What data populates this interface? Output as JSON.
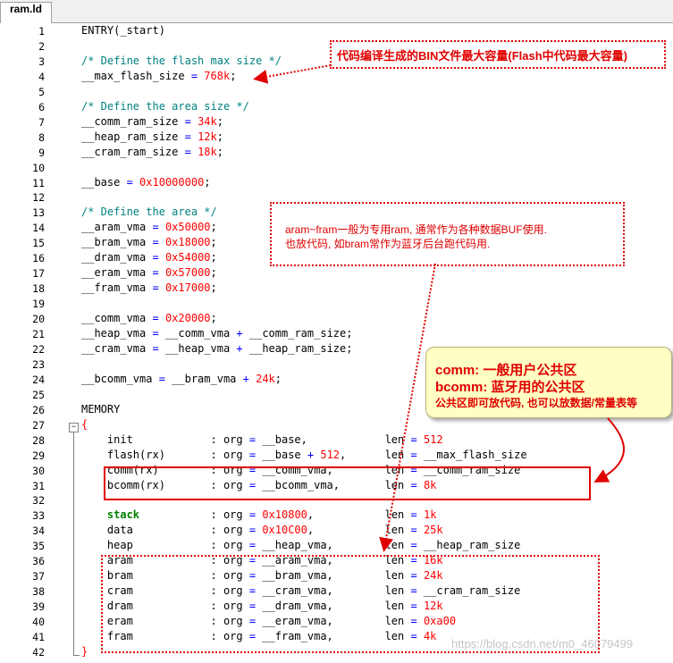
{
  "tab": {
    "label": "ram.ld"
  },
  "lines": [
    {
      "n": "1",
      "parts": [
        [
          "",
          "ENTRY(_start)"
        ]
      ]
    },
    {
      "n": "2",
      "parts": []
    },
    {
      "n": "3",
      "parts": [
        [
          "cm",
          "/* Define the flash max size */"
        ]
      ]
    },
    {
      "n": "4",
      "parts": [
        [
          "",
          "__max_flash_size "
        ],
        [
          "op",
          "="
        ],
        [
          "",
          " "
        ],
        [
          "num",
          "768k"
        ],
        [
          "",
          ";"
        ]
      ]
    },
    {
      "n": "5",
      "parts": []
    },
    {
      "n": "6",
      "parts": [
        [
          "cm",
          "/* Define the area size */"
        ]
      ]
    },
    {
      "n": "7",
      "parts": [
        [
          "",
          "__comm_ram_size "
        ],
        [
          "op",
          "="
        ],
        [
          "",
          " "
        ],
        [
          "num",
          "34k"
        ],
        [
          "",
          ";"
        ]
      ]
    },
    {
      "n": "8",
      "parts": [
        [
          "",
          "__heap_ram_size "
        ],
        [
          "op",
          "="
        ],
        [
          "",
          " "
        ],
        [
          "num",
          "12k"
        ],
        [
          "",
          ";"
        ]
      ]
    },
    {
      "n": "9",
      "parts": [
        [
          "",
          "__cram_ram_size "
        ],
        [
          "op",
          "="
        ],
        [
          "",
          " "
        ],
        [
          "num",
          "18k"
        ],
        [
          "",
          ";"
        ]
      ]
    },
    {
      "n": "10",
      "parts": []
    },
    {
      "n": "11",
      "parts": [
        [
          "",
          "__base "
        ],
        [
          "op",
          "="
        ],
        [
          "",
          " "
        ],
        [
          "num",
          "0x10000000"
        ],
        [
          "",
          ";"
        ]
      ]
    },
    {
      "n": "12",
      "parts": []
    },
    {
      "n": "13",
      "parts": [
        [
          "cm",
          "/* Define the area */"
        ]
      ]
    },
    {
      "n": "14",
      "parts": [
        [
          "",
          "__aram_vma "
        ],
        [
          "op",
          "="
        ],
        [
          "",
          " "
        ],
        [
          "num",
          "0x50000"
        ],
        [
          "",
          ";"
        ]
      ]
    },
    {
      "n": "15",
      "parts": [
        [
          "",
          "__bram_vma "
        ],
        [
          "op",
          "="
        ],
        [
          "",
          " "
        ],
        [
          "num",
          "0x18000"
        ],
        [
          "",
          ";"
        ]
      ]
    },
    {
      "n": "16",
      "parts": [
        [
          "",
          "__dram_vma "
        ],
        [
          "op",
          "="
        ],
        [
          "",
          " "
        ],
        [
          "num",
          "0x54000"
        ],
        [
          "",
          ";"
        ]
      ]
    },
    {
      "n": "17",
      "parts": [
        [
          "",
          "__eram_vma "
        ],
        [
          "op",
          "="
        ],
        [
          "",
          " "
        ],
        [
          "num",
          "0x57000"
        ],
        [
          "",
          ";"
        ]
      ]
    },
    {
      "n": "18",
      "parts": [
        [
          "",
          "__fram_vma "
        ],
        [
          "op",
          "="
        ],
        [
          "",
          " "
        ],
        [
          "num",
          "0x17000"
        ],
        [
          "",
          ";"
        ]
      ]
    },
    {
      "n": "19",
      "parts": []
    },
    {
      "n": "20",
      "parts": [
        [
          "",
          "__comm_vma "
        ],
        [
          "op",
          "="
        ],
        [
          "",
          " "
        ],
        [
          "num",
          "0x20000"
        ],
        [
          "",
          ";"
        ]
      ]
    },
    {
      "n": "21",
      "parts": [
        [
          "",
          "__heap_vma "
        ],
        [
          "op",
          "="
        ],
        [
          "",
          " __comm_vma "
        ],
        [
          "op",
          "+"
        ],
        [
          "",
          " __comm_ram_size;"
        ]
      ]
    },
    {
      "n": "22",
      "parts": [
        [
          "",
          "__cram_vma "
        ],
        [
          "op",
          "="
        ],
        [
          "",
          " __heap_vma "
        ],
        [
          "op",
          "+"
        ],
        [
          "",
          " __heap_ram_size;"
        ]
      ]
    },
    {
      "n": "23",
      "parts": []
    },
    {
      "n": "24",
      "parts": [
        [
          "",
          "__bcomm_vma "
        ],
        [
          "op",
          "="
        ],
        [
          "",
          " __bram_vma "
        ],
        [
          "op",
          "+"
        ],
        [
          "",
          " "
        ],
        [
          "num",
          "24k"
        ],
        [
          "",
          ";"
        ]
      ]
    },
    {
      "n": "25",
      "parts": []
    },
    {
      "n": "26",
      "parts": [
        [
          "",
          "MEMORY"
        ]
      ]
    },
    {
      "n": "27",
      "parts": [
        [
          "num",
          "{"
        ]
      ]
    },
    {
      "n": "28",
      "parts": [
        [
          "",
          "    init            : org "
        ],
        [
          "op",
          "="
        ],
        [
          "",
          " __base,            len "
        ],
        [
          "op",
          "="
        ],
        [
          "",
          " "
        ],
        [
          "num",
          "512"
        ]
      ]
    },
    {
      "n": "29",
      "parts": [
        [
          "",
          "    flash(rx)       : org "
        ],
        [
          "op",
          "="
        ],
        [
          "",
          " __base "
        ],
        [
          "op",
          "+"
        ],
        [
          "",
          " "
        ],
        [
          "num",
          "512"
        ],
        [
          "",
          ",      len "
        ],
        [
          "op",
          "="
        ],
        [
          "",
          " __max_flash_size"
        ]
      ]
    },
    {
      "n": "30",
      "parts": [
        [
          "",
          "    comm(rx)        : org "
        ],
        [
          "op",
          "="
        ],
        [
          "",
          " __comm_vma,        len "
        ],
        [
          "op",
          "="
        ],
        [
          "",
          " __comm_ram_size"
        ]
      ]
    },
    {
      "n": "31",
      "parts": [
        [
          "",
          "    bcomm(rx)       : org "
        ],
        [
          "op",
          "="
        ],
        [
          "",
          " __bcomm_vma,       len "
        ],
        [
          "op",
          "="
        ],
        [
          "",
          " "
        ],
        [
          "num",
          "8k"
        ]
      ]
    },
    {
      "n": "32",
      "parts": []
    },
    {
      "n": "33",
      "parts": [
        [
          "",
          "    "
        ],
        [
          "kw",
          "stack"
        ],
        [
          "",
          "           : org "
        ],
        [
          "op",
          "="
        ],
        [
          "",
          " "
        ],
        [
          "num",
          "0x10800"
        ],
        [
          "",
          ",           len "
        ],
        [
          "op",
          "="
        ],
        [
          "",
          " "
        ],
        [
          "num",
          "1k"
        ]
      ]
    },
    {
      "n": "34",
      "parts": [
        [
          "",
          "    data            : org "
        ],
        [
          "op",
          "="
        ],
        [
          "",
          " "
        ],
        [
          "num",
          "0x10C00"
        ],
        [
          "",
          ",           len "
        ],
        [
          "op",
          "="
        ],
        [
          "",
          " "
        ],
        [
          "num",
          "25k"
        ]
      ]
    },
    {
      "n": "35",
      "parts": [
        [
          "",
          "    heap            : org "
        ],
        [
          "op",
          "="
        ],
        [
          "",
          " __heap_vma,        len "
        ],
        [
          "op",
          "="
        ],
        [
          "",
          " __heap_ram_size"
        ]
      ]
    },
    {
      "n": "36",
      "parts": [
        [
          "",
          "    aram            : org "
        ],
        [
          "op",
          "="
        ],
        [
          "",
          " __aram_vma,        len "
        ],
        [
          "op",
          "="
        ],
        [
          "",
          " "
        ],
        [
          "num",
          "16k"
        ]
      ]
    },
    {
      "n": "37",
      "parts": [
        [
          "",
          "    bram            : org "
        ],
        [
          "op",
          "="
        ],
        [
          "",
          " __bram_vma,        len "
        ],
        [
          "op",
          "="
        ],
        [
          "",
          " "
        ],
        [
          "num",
          "24k"
        ]
      ]
    },
    {
      "n": "38",
      "parts": [
        [
          "",
          "    cram            : org "
        ],
        [
          "op",
          "="
        ],
        [
          "",
          " __cram_vma,        len "
        ],
        [
          "op",
          "="
        ],
        [
          "",
          " __cram_ram_size"
        ]
      ]
    },
    {
      "n": "39",
      "parts": [
        [
          "",
          "    dram            : org "
        ],
        [
          "op",
          "="
        ],
        [
          "",
          " __dram_vma,        len "
        ],
        [
          "op",
          "="
        ],
        [
          "",
          " "
        ],
        [
          "num",
          "12k"
        ]
      ]
    },
    {
      "n": "40",
      "parts": [
        [
          "",
          "    eram            : org "
        ],
        [
          "op",
          "="
        ],
        [
          "",
          " __eram_vma,        len "
        ],
        [
          "op",
          "="
        ],
        [
          "",
          " "
        ],
        [
          "num",
          "0xa00"
        ]
      ]
    },
    {
      "n": "41",
      "parts": [
        [
          "",
          "    fram            : org "
        ],
        [
          "op",
          "="
        ],
        [
          "",
          " __fram_vma,        len "
        ],
        [
          "op",
          "="
        ],
        [
          "",
          " "
        ],
        [
          "num",
          "4k"
        ]
      ]
    },
    {
      "n": "42",
      "parts": [
        [
          "num",
          "}"
        ]
      ]
    }
  ],
  "annotations": {
    "flash_note": "代码编译生成的BIN文件最大容量(Flash中代码最大容量)",
    "ram_note_line1": "aram~fram一般为专用ram, 通常作为各种数据BUF使用.",
    "ram_note_line2": "也放代码, 如bram常作为蓝牙后台跑代码用.",
    "comm_line1": "comm: 一般用户公共区",
    "comm_line2": "bcomm: 蓝牙用的公共区",
    "comm_line3": "公共区即可放代码, 也可以放数据/常量表等"
  },
  "watermark": "https://blog.csdn.net/m0_46079499",
  "colors": {
    "comment": "#008080",
    "number": "#ff0000",
    "operator": "#0000ff",
    "keyword": "#008000",
    "annotation": "#e00000",
    "callout_bg": "#ffffc4"
  }
}
